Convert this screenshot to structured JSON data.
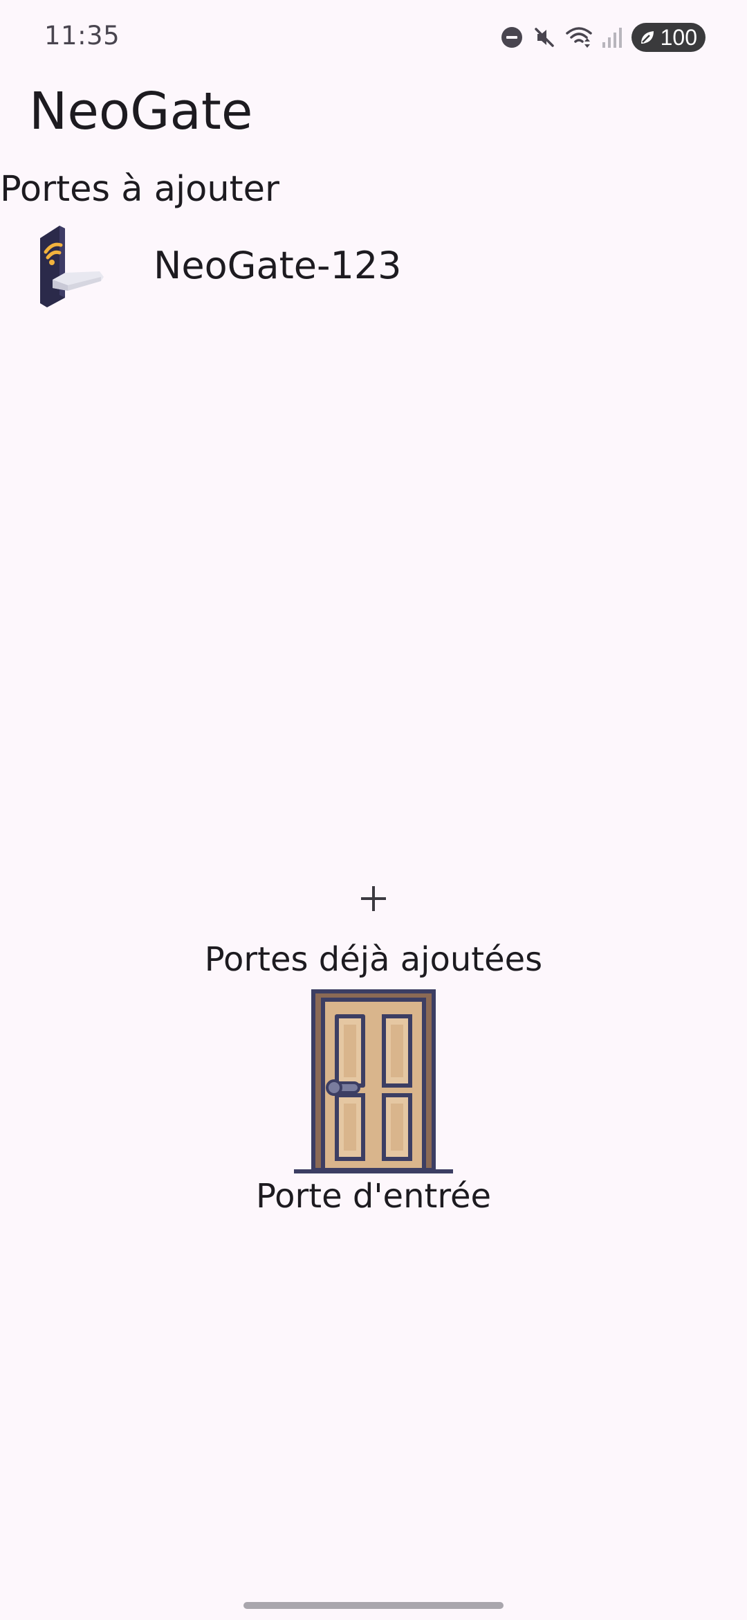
{
  "status_bar": {
    "time": "11:35",
    "icons": [
      "do-not-disturb-icon",
      "mute-icon",
      "wifi-icon",
      "signal-icon",
      "battery-saver-icon"
    ],
    "battery_level": "100"
  },
  "app": {
    "title": "NeoGate"
  },
  "doors_to_add": {
    "heading": "Portes à ajouter",
    "items": [
      {
        "label": "NeoGate-123",
        "icon": "smart-lock-icon"
      }
    ]
  },
  "add_button": {
    "icon": "plus-icon"
  },
  "doors_added": {
    "heading": "Portes déjà ajoutées",
    "items": [
      {
        "label": "Porte d'entrée",
        "icon": "door-icon"
      }
    ]
  },
  "colors": {
    "background": "#fdf7fc",
    "text": "#1d1b20",
    "lock_body": "#2b2a4a",
    "lock_wifi": "#f2b33d",
    "door_wood": "#d9b58c",
    "door_frame": "#3c3e63"
  }
}
